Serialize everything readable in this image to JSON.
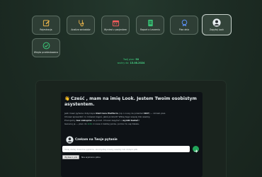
{
  "tiles": [
    {
      "label": "Rejestracja",
      "icon": "edit-icon"
    },
    {
      "label": "Analiza wniosków",
      "icon": "stethoscope-icon"
    },
    {
      "label": "Wyniesł z pacjentem",
      "icon": "calendar-icon"
    },
    {
      "label": "Raport o Leczeniu",
      "icon": "document-icon"
    },
    {
      "label": "Plan dnia",
      "icon": "badge-icon"
    },
    {
      "label": "Zapytaj Look",
      "icon": "user-avatar-icon"
    },
    {
      "label": "Wizyta przetestowana",
      "icon": "check-circle-icon"
    }
  ],
  "info": {
    "line1_prefix": "Twój plan:",
    "line1_value": "50",
    "line2_prefix": "ważny do:",
    "line2_value": "15.08.2024"
  },
  "assistant": {
    "heading": "Cześć , mam na imię Look. Jestem Twoim osobistym asystentem.",
    "p1_a": "Jeśli masz pytanie dotyczące",
    "p1_b": "Diet Care Platform",
    "p1_c": "(np o nowy ze przekład",
    "p1_d": "DCP",
    "p1_e": ") — śmiało pisz.",
    "p2": "Chcesz sprawdzić co mówisz kogoś, jakiś produkt? Wklej tego więcej link wiedzy.",
    "p3_a": "Pracujemy",
    "p3_b": "bez zakupów",
    "p3_c": "na porad. Chcesz zapytać o",
    "p3_d": "wyniki badań",
    "p3_e": "?",
    "p4_a": "Generuj je — plan do",
    "p4_b": "zrób",
    "p4_c": "z nowe z każdej porze, pomoc tu się Dalele.",
    "prompt_title": "Czekam na Twoje pytanie",
    "input_placeholder": "Tutaj zadaj dowolne pytanie, skorzystaj z bazy wiedzy lub dołącz plik.",
    "file_button": "Wybierz plik",
    "file_status": "Nie wybrano pliku"
  },
  "colors": {
    "accent": "#3ac477",
    "send": "#22a55a"
  }
}
